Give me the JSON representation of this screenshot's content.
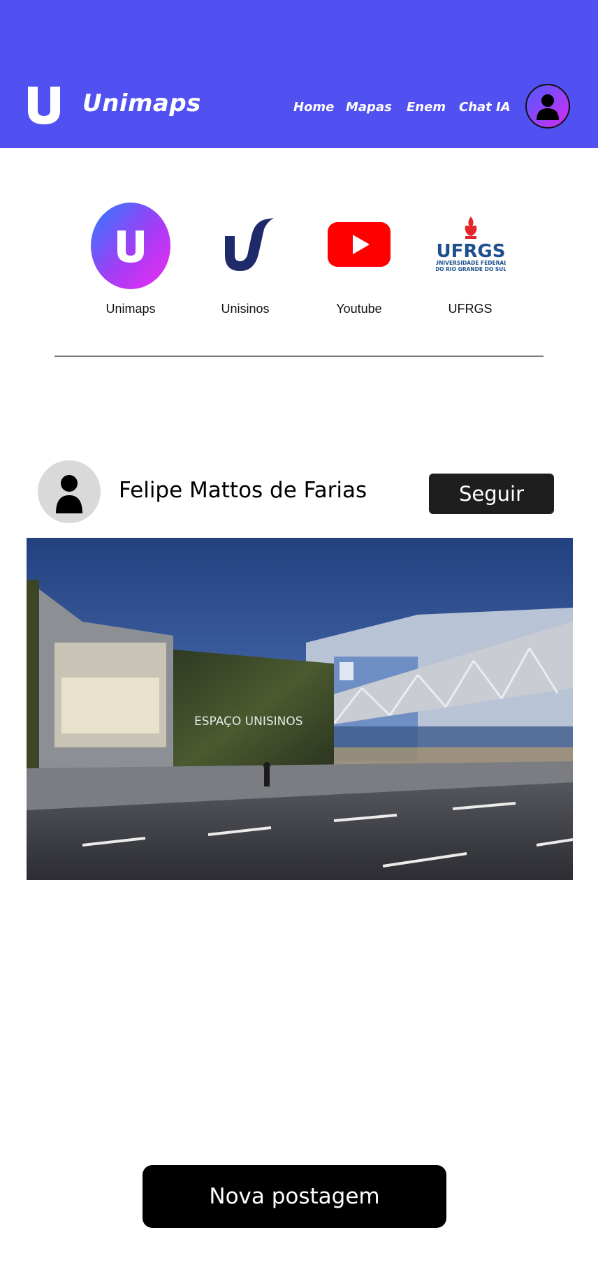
{
  "header": {
    "brand_letter": "U",
    "brand_name": "Unimaps",
    "nav": {
      "home": "Home",
      "mapas": "Mapas",
      "enem": "Enem",
      "chat": "Chat IA"
    },
    "avatar_icon": "user-icon"
  },
  "shortcuts": [
    {
      "label": "Unimaps",
      "icon": "unimaps-logo",
      "letter": "U"
    },
    {
      "label": "Unisinos",
      "icon": "unisinos-logo"
    },
    {
      "label": "Youtube",
      "icon": "youtube-logo"
    },
    {
      "label": "UFRGS",
      "icon": "ufrgs-logo",
      "logo_text": "UFRGS",
      "logo_sub1": "UNIVERSIDADE FEDERAL",
      "logo_sub2": "DO RIO GRANDE DO SUL"
    }
  ],
  "post": {
    "author": "Felipe Mattos de Farias",
    "follow_label": "Seguir",
    "image_sign": "ESPAÇO UNISINOS"
  },
  "new_post_label": "Nova postagem",
  "colors": {
    "header_bg": "#5151f2",
    "button_dark": "#1e1e1e",
    "youtube_red": "#ff0000",
    "unisinos_blue": "#1f2a6b"
  }
}
